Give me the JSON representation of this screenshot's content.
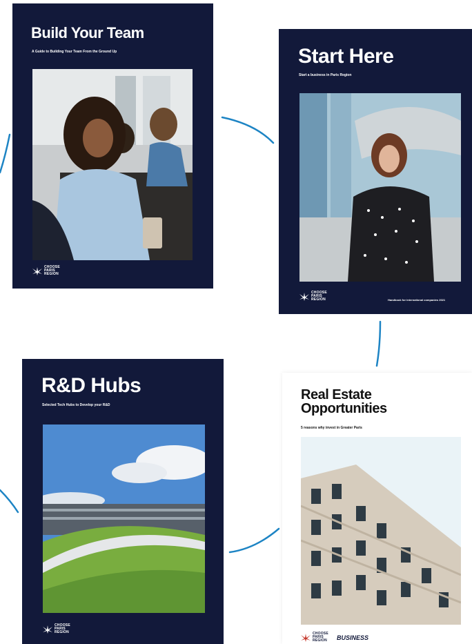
{
  "colors": {
    "navy": "#12193a",
    "connector": "#1d84c4",
    "white": "#ffffff"
  },
  "brochures": [
    {
      "id": "build-your-team",
      "title": "Build Your Team",
      "subtitle": "A Guide to Building Your Team From the Ground Up",
      "photo": "office meeting with smiling woman"
    },
    {
      "id": "start-here",
      "title": "Start Here",
      "subtitle": "Start a business in Paris Region",
      "footer_note": "Handbook for international companies 2021",
      "photo": "woman standing in business district"
    },
    {
      "id": "rd-hubs",
      "title": "R&D Hubs",
      "subtitle": "Selected Tech Hubs to Develop your R&D",
      "photo": "modern building with green curved roof"
    },
    {
      "id": "real-estate",
      "title": "Real Estate Opportunities",
      "subtitle": "5 reasons why invest in Greater Paris",
      "photo": "parisian building facade",
      "partner": "BUSINESS"
    }
  ],
  "logo": {
    "icon": "choose-paris-region-logo-icon",
    "line1": "CHOOSE",
    "line2": "PARIS",
    "line3": "REGION"
  }
}
